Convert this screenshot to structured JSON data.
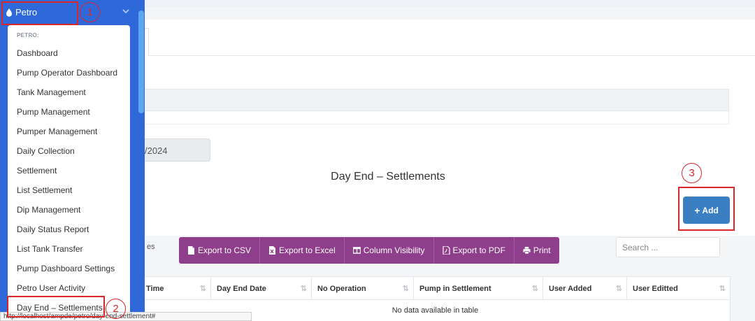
{
  "sidebar": {
    "module_label": "Petro",
    "section_header": "PETRO:",
    "items": [
      {
        "label": "Dashboard"
      },
      {
        "label": "Pump Operator Dashboard"
      },
      {
        "label": "Tank Management"
      },
      {
        "label": "Pump Management"
      },
      {
        "label": "Pumper Management"
      },
      {
        "label": "Daily Collection"
      },
      {
        "label": "Settlement"
      },
      {
        "label": "List Settlement"
      },
      {
        "label": "Dip Management"
      },
      {
        "label": "Daily Status Report"
      },
      {
        "label": "List Tank Transfer"
      },
      {
        "label": "Pump Dashboard Settings"
      },
      {
        "label": "Petro User Activity"
      },
      {
        "label": "Day End – Settlements"
      }
    ]
  },
  "main": {
    "date_value": "/2024",
    "page_title": "Day End – Settlements",
    "add_button": "Add",
    "entries_label": "es",
    "export_buttons": [
      "Export to CSV",
      "Export to Excel",
      "Column Visibility",
      "Export to PDF",
      "Print"
    ],
    "search_placeholder": "Search ...",
    "table": {
      "columns": [
        "Time",
        "Day End Date",
        "No Operation",
        "Pump in Settlement",
        "User Added",
        "User Editted"
      ],
      "empty_message": "No data available in table"
    }
  },
  "annotations": [
    "1",
    "2",
    "3"
  ],
  "status_url": "http://localhost/ampde/petro/day-end-settlement#",
  "colors": {
    "sidebar": "#2f69d9",
    "export_button": "#8f3e8b",
    "add_button": "#3a7fc1",
    "annotation": "#d9262b"
  }
}
